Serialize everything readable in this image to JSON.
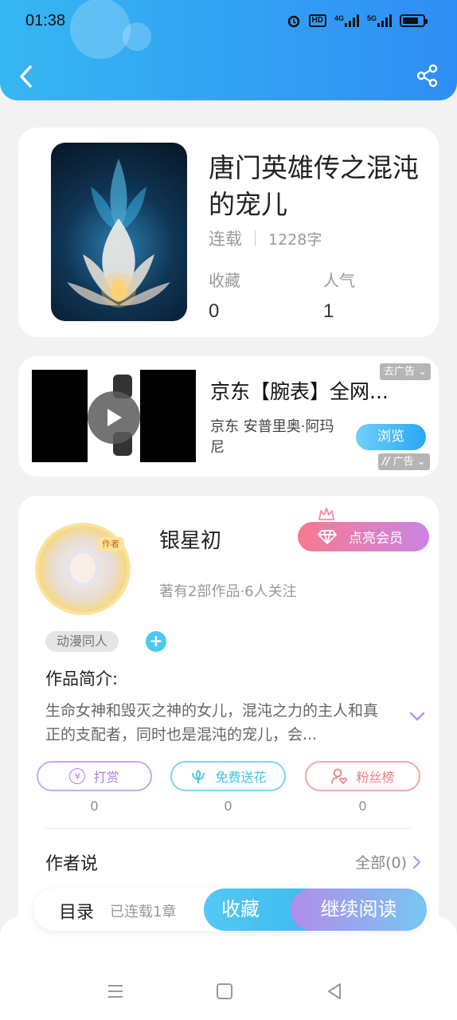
{
  "status_bar": {
    "time": "01:38",
    "hd": "HD",
    "net1": "4G",
    "net2": "5G"
  },
  "book": {
    "title": "唐门英雄传之混沌的宠儿",
    "status": "连载",
    "words": "1228字",
    "stats": [
      {
        "label": "收藏",
        "value": "0"
      },
      {
        "label": "人气",
        "value": "1"
      }
    ]
  },
  "ad": {
    "title": "京东【腕表】全网...",
    "description": "京东 安普里奥·阿玛尼",
    "button": "浏览",
    "close_tag": "去广告",
    "ad_tag": "广告"
  },
  "author": {
    "avatar_tag": "作者",
    "name": "银星初",
    "vip_label": "点亮会员",
    "stats": "著有2部作品·6人关注",
    "genre": "动漫同人",
    "add": "+",
    "intro_label": "作品简介:",
    "intro_text": "生命女神和毁灭之神的女儿，混沌之力的主人和真正的支配者，同时也是混沌的宠儿，会..."
  },
  "actions": [
    {
      "label": "打赏",
      "count": "0",
      "color": "#b07ee0"
    },
    {
      "label": "免费送花",
      "count": "0",
      "color": "#3fc3e4"
    },
    {
      "label": "粉丝榜",
      "count": "0",
      "color": "#ee7e7e"
    }
  ],
  "author_says": {
    "title": "作者说",
    "all": "全部(0)"
  },
  "bottom_bar": {
    "toc": "目录",
    "serial": "已连载1章",
    "favorite": "收藏",
    "continue": "继续阅读"
  }
}
